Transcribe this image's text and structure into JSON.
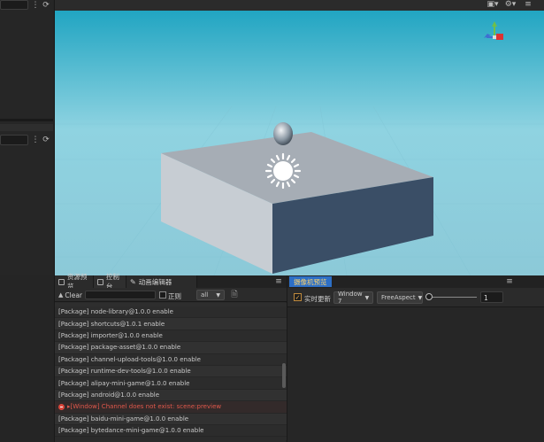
{
  "left": {
    "top_refresh_icon": "refresh-icon",
    "mid_refresh_icon": "refresh-icon"
  },
  "scene": {
    "toolbar_icons": [
      "camera-icon",
      "gear-icon"
    ]
  },
  "console": {
    "tabs": [
      {
        "label": "资源预览",
        "icon": "folder-icon"
      },
      {
        "label": "控制台",
        "icon": "console-icon"
      },
      {
        "label": "动画编辑器",
        "icon": "animation-icon"
      }
    ],
    "clear_label": "Clear",
    "search_value": "",
    "regex_label": "正则",
    "filter_value": "all",
    "logs": [
      {
        "text": "[Package] node-library@1.0.0 enable",
        "level": "info"
      },
      {
        "text": "[Package] shortcuts@1.0.1 enable",
        "level": "info"
      },
      {
        "text": "[Package] importer@1.0.0 enable",
        "level": "info"
      },
      {
        "text": "[Package] package-asset@1.0.0 enable",
        "level": "info"
      },
      {
        "text": "[Package] channel-upload-tools@1.0.0 enable",
        "level": "info"
      },
      {
        "text": "[Package] runtime-dev-tools@1.0.0 enable",
        "level": "info"
      },
      {
        "text": "[Package] alipay-mini-game@1.0.0 enable",
        "level": "info"
      },
      {
        "text": "[Package] android@1.0.0 enable",
        "level": "info"
      },
      {
        "text": "[Window] Channel does not exist: scene:preview",
        "level": "error"
      },
      {
        "text": "[Package] baidu-mini-game@1.0.0 enable",
        "level": "info"
      },
      {
        "text": "[Package] bytedance-mini-game@1.0.0 enable",
        "level": "info"
      }
    ]
  },
  "preview": {
    "tab_label": "摄像机预览",
    "realtime_label": "实时更新",
    "realtime_checked": true,
    "window_value": "Window 7",
    "aspect_value": "FreeAspect",
    "scale_value": "1",
    "slider_level": 0
  },
  "colors": {
    "accent": "#2d6fc6",
    "error": "#e0584b",
    "sky": "#7fc7d6"
  }
}
